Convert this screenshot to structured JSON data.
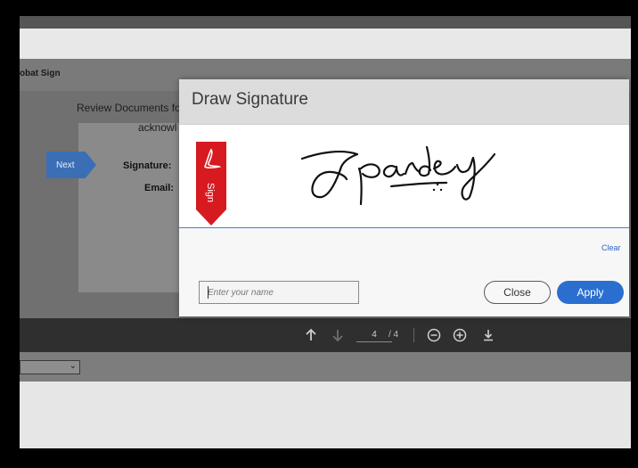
{
  "background_app": {
    "title": "obat Sign",
    "review_text": "Review Documents fo",
    "ack_text": "acknowl",
    "next_label": "Next",
    "signature_label": "Signature:",
    "email_label": "Email:"
  },
  "pdf_toolbar": {
    "current_page": "4",
    "total_pages": "/ 4",
    "icons": [
      "arrow-up-icon",
      "arrow-down-icon",
      "zoom-out-icon",
      "zoom-in-icon",
      "download-icon"
    ]
  },
  "modal": {
    "title": "Draw Signature",
    "sign_tag_label": "Sign",
    "drawn_signature": "Jpandey",
    "clear_label": "Clear",
    "name_placeholder": "Enter your name",
    "name_value": "",
    "close_label": "Close",
    "apply_label": "Apply"
  },
  "colors": {
    "accent": "#2a6fd0",
    "sign_tag": "#d71920",
    "next_button": "#3a6fb5"
  }
}
